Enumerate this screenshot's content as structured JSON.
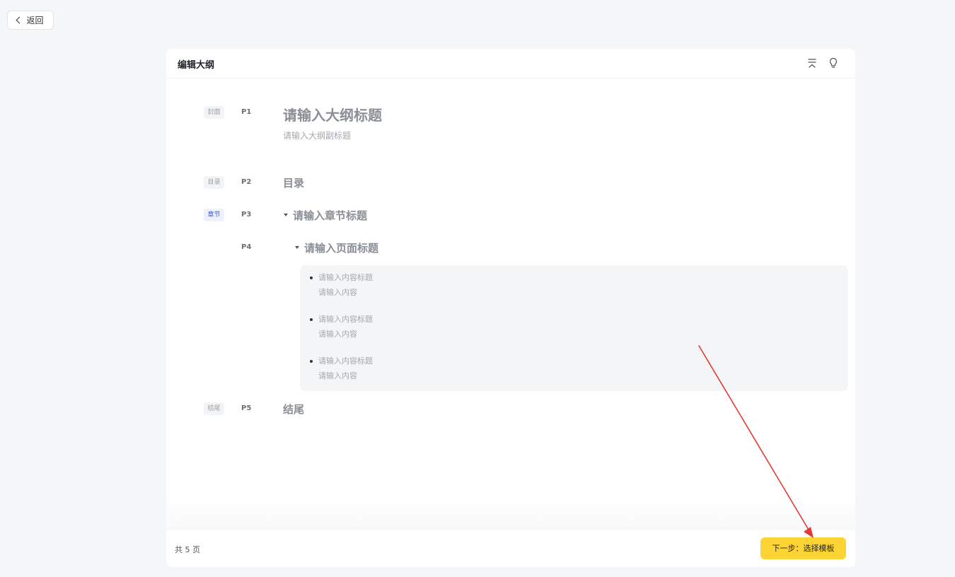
{
  "back_button": {
    "label": "返回"
  },
  "editor": {
    "title": "编辑大纲",
    "icons": [
      "collapse-all-icon",
      "lightbulb-icon"
    ]
  },
  "outline": {
    "cover": {
      "tag": "封面",
      "page": "P1",
      "title_placeholder": "请输入大纲标题",
      "subtitle_placeholder": "请输入大纲副标题"
    },
    "toc": {
      "tag": "目录",
      "page": "P2",
      "title": "目录"
    },
    "chapter": {
      "tag": "章节",
      "page": "P3",
      "title_placeholder": "请输入章节标题"
    },
    "page": {
      "page": "P4",
      "title_placeholder": "请输入页面标题",
      "items": [
        {
          "title": "请输入内容标题",
          "content": "请输入内容"
        },
        {
          "title": "请输入内容标题",
          "content": "请输入内容"
        },
        {
          "title": "请输入内容标题",
          "content": "请输入内容"
        }
      ]
    },
    "ending": {
      "tag": "结尾",
      "page": "P5",
      "title": "结尾"
    }
  },
  "footer": {
    "page_count": "共 5 页",
    "next_button": "下一步：选择模板"
  },
  "colors": {
    "accent_button": "#fcd535",
    "chapter_tag": "#3d5bd9",
    "annotation_arrow": "#e53935"
  }
}
